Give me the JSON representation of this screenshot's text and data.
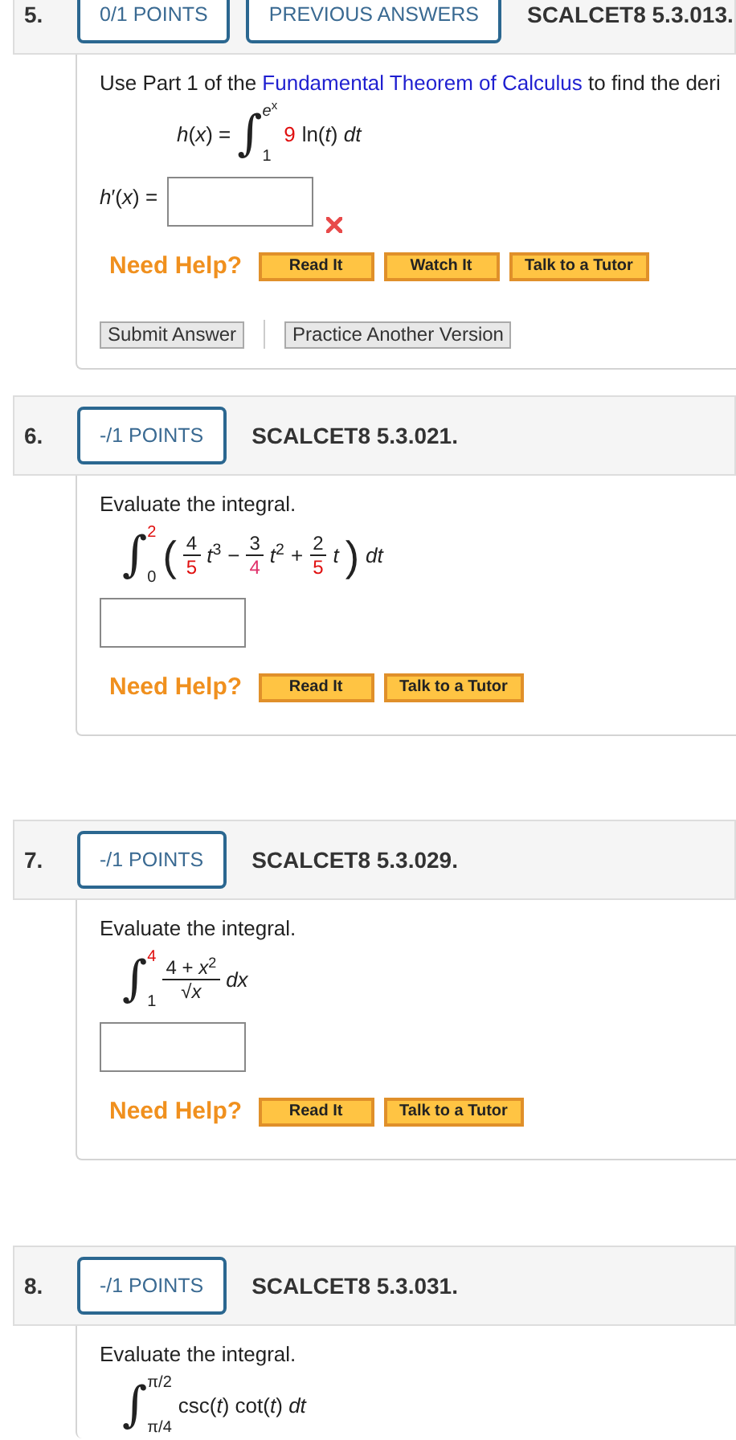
{
  "questions": [
    {
      "number": "5.",
      "badges": [
        "0/1 POINTS",
        "PREVIOUS ANSWERS"
      ],
      "code": "SCALCET8 5.3.013.",
      "prompt": [
        {
          "text": "Use Part 1 of the "
        },
        {
          "text": "Fundamental Theorem of Calculus",
          "link": true
        },
        {
          "text": " to find the deri"
        }
      ],
      "formula": [
        {
          "kind": "text",
          "text": "*h*(*x*) ="
        },
        {
          "kind": "integral",
          "sign": "∫",
          "upper": {
            "text": "*e*$^{x}$"
          },
          "lower": {
            "text": "1"
          }
        },
        {
          "kind": "text",
          "text": "9",
          "color": "#e01010"
        },
        {
          "kind": "text",
          "text": "ln(*t*) *dt*"
        }
      ],
      "answers": [
        {
          "kind": "labeled",
          "label": "*h*′(*x*) =",
          "incorrect": true
        }
      ],
      "help_label": "Need Help?",
      "help_buttons": [
        "Read It",
        "Watch It",
        "Talk to a Tutor"
      ],
      "actions": [
        "Submit Answer",
        "Practice Another Version"
      ]
    },
    {
      "number": "6.",
      "badges": [
        "-/1 POINTS"
      ],
      "code": "SCALCET8 5.3.021.",
      "prompt": [
        {
          "text": "Evaluate the integral."
        }
      ],
      "formula": [
        {
          "kind": "integral",
          "sign": "∫",
          "upper": {
            "text": "2",
            "color": "#e01010"
          },
          "lower": {
            "text": "0"
          }
        },
        {
          "kind": "paren",
          "text": "("
        },
        {
          "kind": "fraction",
          "num": {
            "text": "4"
          },
          "den": {
            "text": "5",
            "color": "#e01010"
          }
        },
        {
          "kind": "text",
          "text": "*t*$^{3}$"
        },
        {
          "kind": "text",
          "text": "−"
        },
        {
          "kind": "fraction",
          "num": {
            "text": "3"
          },
          "den": {
            "text": "4",
            "color": "#e0306a"
          }
        },
        {
          "kind": "text",
          "text": "*t*$^{2}$"
        },
        {
          "kind": "text",
          "text": "+"
        },
        {
          "kind": "fraction",
          "num": {
            "text": "2"
          },
          "den": {
            "text": "5",
            "color": "#e01010"
          }
        },
        {
          "kind": "text",
          "text": "*t*"
        },
        {
          "kind": "paren",
          "text": ")"
        },
        {
          "kind": "text",
          "text": "*dt*"
        }
      ],
      "answers": [
        {
          "kind": "blank"
        }
      ],
      "help_label": "Need Help?",
      "help_buttons": [
        "Read It",
        "Talk to a Tutor"
      ]
    },
    {
      "number": "7.",
      "badges": [
        "-/1 POINTS"
      ],
      "code": "SCALCET8 5.3.029.",
      "prompt": [
        {
          "text": "Evaluate the integral."
        }
      ],
      "formula": [
        {
          "kind": "integral",
          "sign": "∫",
          "upper": {
            "text": "4",
            "color": "#e01010"
          },
          "lower": {
            "text": "1"
          }
        },
        {
          "kind": "fraction",
          "num": {
            "text": "4 + *x*$^{2}$"
          },
          "den": {
            "text": "√*x*"
          }
        },
        {
          "kind": "text",
          "text": "*dx*"
        }
      ],
      "answers": [
        {
          "kind": "blank"
        }
      ],
      "help_label": "Need Help?",
      "help_buttons": [
        "Read It",
        "Talk to a Tutor"
      ]
    },
    {
      "number": "8.",
      "badges": [
        "-/1 POINTS"
      ],
      "code": "SCALCET8 5.3.031.",
      "prompt": [
        {
          "text": "Evaluate the integral."
        }
      ],
      "formula": [
        {
          "kind": "integral",
          "sign": "∫",
          "upper": {
            "text": "π/2"
          },
          "lower": {
            "text": "π/4"
          }
        },
        {
          "kind": "text",
          "text": "csc(*t*) cot(*t*) *dt*"
        }
      ]
    }
  ]
}
